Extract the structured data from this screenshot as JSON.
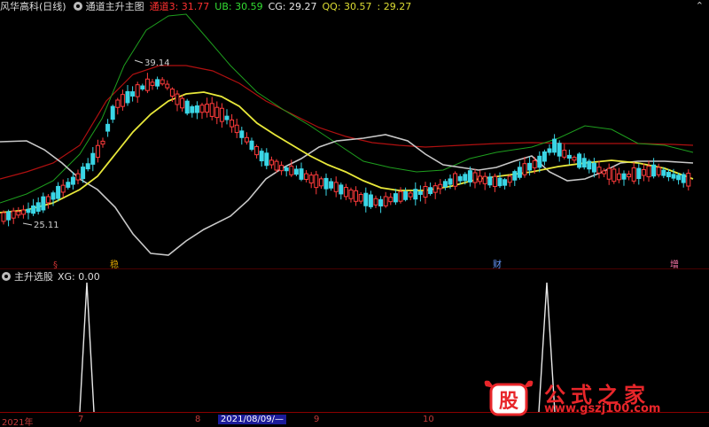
{
  "header": {
    "stock_name": "风华高科(日线)",
    "indicator_name": "通道主升主图",
    "values": [
      {
        "label": "通道3: 31.77",
        "color": "#ff3030"
      },
      {
        "label": "UB: 30.59",
        "color": "#33dd33"
      },
      {
        "label": "CG: 29.27",
        "color": "#e8e8e8"
      },
      {
        "label": "QQ: 30.57",
        "color": "#dddd33"
      },
      {
        "label": ": 29.27",
        "color": "#dddd33"
      }
    ],
    "window_button": "⌃"
  },
  "main_chart": {
    "high_label": "39.14",
    "low_label": "25.11",
    "tags": [
      {
        "text": "§",
        "color": "#cc3333"
      },
      {
        "text": "稳",
        "color": "#d8a000"
      },
      {
        "text": "财",
        "color": "#6699ff"
      },
      {
        "text": "增",
        "color": "#ff77aa"
      }
    ]
  },
  "lower_panel": {
    "title": "主升选股",
    "value": "XG: 0.00"
  },
  "time_axis": {
    "labels": [
      "2021年",
      "7",
      "8",
      "2021/08/09/—",
      "9",
      "10"
    ],
    "highlight_index": 3
  },
  "watermark": {
    "name": "公式之家",
    "url": "www.gszj100.com",
    "mark_text": "股"
  }
}
